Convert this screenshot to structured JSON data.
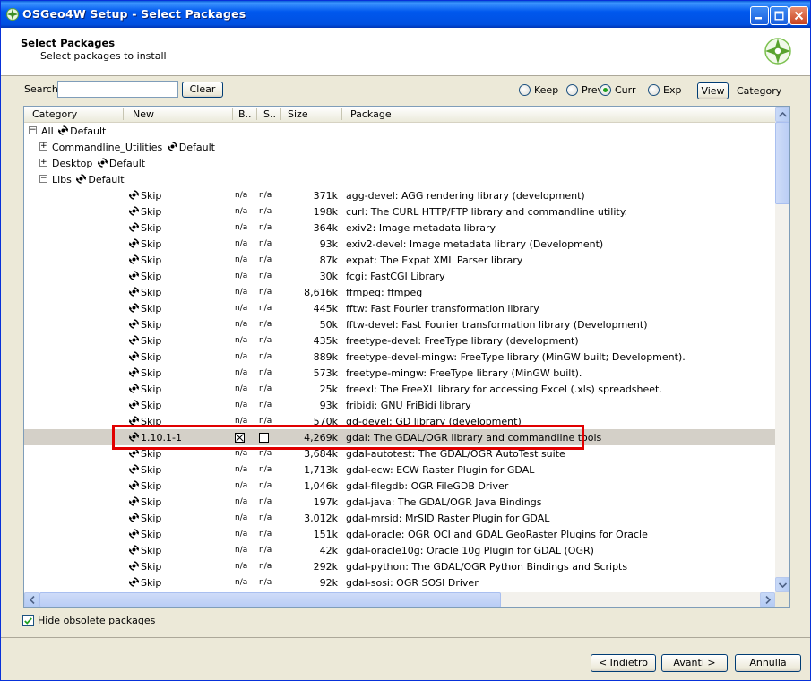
{
  "window": {
    "title": "OSGeo4W Setup - Select Packages",
    "title_bar_color": "#0058ee"
  },
  "header": {
    "title": "Select Packages",
    "subtitle": "Select packages to install"
  },
  "search": {
    "label": "Search",
    "value": "",
    "clear_label": "Clear"
  },
  "view_options": {
    "keep": "Keep",
    "prev": "Prev",
    "curr": "Curr",
    "exp": "Exp",
    "selected": "curr",
    "view_label": "View",
    "view_mode": "Category"
  },
  "columns": {
    "category": "Category",
    "new": "New",
    "bin": "B..",
    "src": "S..",
    "size": "Size",
    "package": "Package"
  },
  "tree": [
    {
      "id": "all",
      "toggle": "⊟",
      "label": "All",
      "mode": "Default"
    },
    {
      "id": "cmd",
      "toggle": "⊞",
      "label": "Commandline_Utilities",
      "mode": "Default"
    },
    {
      "id": "desk",
      "toggle": "⊞",
      "label": "Desktop",
      "mode": "Default"
    },
    {
      "id": "libs",
      "toggle": "⊟",
      "label": "Libs",
      "mode": "Default"
    }
  ],
  "packages": [
    {
      "new": "Skip",
      "bin": "n/a",
      "src": "n/a",
      "size": "371k",
      "desc": "agg-devel: AGG rendering library (development)"
    },
    {
      "new": "Skip",
      "bin": "n/a",
      "src": "n/a",
      "size": "198k",
      "desc": "curl: The CURL HTTP/FTP library and commandline utility."
    },
    {
      "new": "Skip",
      "bin": "n/a",
      "src": "n/a",
      "size": "364k",
      "desc": "exiv2: Image metadata library"
    },
    {
      "new": "Skip",
      "bin": "n/a",
      "src": "n/a",
      "size": "93k",
      "desc": "exiv2-devel: Image metadata library (Development)"
    },
    {
      "new": "Skip",
      "bin": "n/a",
      "src": "n/a",
      "size": "87k",
      "desc": "expat: The Expat XML Parser library"
    },
    {
      "new": "Skip",
      "bin": "n/a",
      "src": "n/a",
      "size": "30k",
      "desc": "fcgi: FastCGI Library"
    },
    {
      "new": "Skip",
      "bin": "n/a",
      "src": "n/a",
      "size": "8,616k",
      "desc": "ffmpeg: ffmpeg"
    },
    {
      "new": "Skip",
      "bin": "n/a",
      "src": "n/a",
      "size": "445k",
      "desc": "fftw: Fast Fourier transformation library"
    },
    {
      "new": "Skip",
      "bin": "n/a",
      "src": "n/a",
      "size": "50k",
      "desc": "fftw-devel: Fast Fourier transformation library (Development)"
    },
    {
      "new": "Skip",
      "bin": "n/a",
      "src": "n/a",
      "size": "435k",
      "desc": "freetype-devel: FreeType library (development)"
    },
    {
      "new": "Skip",
      "bin": "n/a",
      "src": "n/a",
      "size": "889k",
      "desc": "freetype-devel-mingw: FreeType library (MinGW built; Development)."
    },
    {
      "new": "Skip",
      "bin": "n/a",
      "src": "n/a",
      "size": "573k",
      "desc": "freetype-mingw: FreeType library (MinGW built)."
    },
    {
      "new": "Skip",
      "bin": "n/a",
      "src": "n/a",
      "size": "25k",
      "desc": "freexl: The FreeXL library for accessing Excel (.xls) spreadsheet."
    },
    {
      "new": "Skip",
      "bin": "n/a",
      "src": "n/a",
      "size": "93k",
      "desc": "fribidi: GNU FriBidi library"
    },
    {
      "new": "Skip",
      "bin": "n/a",
      "src": "n/a",
      "size": "570k",
      "desc": "gd-devel: GD library (development)"
    },
    {
      "new": "1.10.1-1",
      "bin_checked": true,
      "src_checked": false,
      "size": "4,269k",
      "desc": "gdal: The GDAL/OGR library and commandline tools",
      "selected": true
    },
    {
      "new": "Skip",
      "bin": "n/a",
      "src": "n/a",
      "size": "3,684k",
      "desc": "gdal-autotest: The GDAL/OGR AutoTest suite"
    },
    {
      "new": "Skip",
      "bin": "n/a",
      "src": "n/a",
      "size": "1,713k",
      "desc": "gdal-ecw: ECW Raster Plugin for GDAL"
    },
    {
      "new": "Skip",
      "bin": "n/a",
      "src": "n/a",
      "size": "1,046k",
      "desc": "gdal-filegdb: OGR FileGDB Driver"
    },
    {
      "new": "Skip",
      "bin": "n/a",
      "src": "n/a",
      "size": "197k",
      "desc": "gdal-java: The GDAL/OGR Java Bindings"
    },
    {
      "new": "Skip",
      "bin": "n/a",
      "src": "n/a",
      "size": "3,012k",
      "desc": "gdal-mrsid: MrSID Raster Plugin for GDAL"
    },
    {
      "new": "Skip",
      "bin": "n/a",
      "src": "n/a",
      "size": "151k",
      "desc": "gdal-oracle: OGR OCI and GDAL GeoRaster Plugins for Oracle"
    },
    {
      "new": "Skip",
      "bin": "n/a",
      "src": "n/a",
      "size": "42k",
      "desc": "gdal-oracle10g: Oracle 10g Plugin for GDAL (OGR)"
    },
    {
      "new": "Skip",
      "bin": "n/a",
      "src": "n/a",
      "size": "292k",
      "desc": "gdal-python: The GDAL/OGR Python Bindings and Scripts"
    },
    {
      "new": "Skip",
      "bin": "n/a",
      "src": "n/a",
      "size": "92k",
      "desc": "gdal-sosi: OGR SOSI Driver"
    }
  ],
  "hide_obsolete": {
    "label": "Hide obsolete packages",
    "checked": true
  },
  "footer": {
    "back": "< Indietro",
    "next": "Avanti >",
    "cancel": "Annulla"
  },
  "highlight_color": "#e10000"
}
